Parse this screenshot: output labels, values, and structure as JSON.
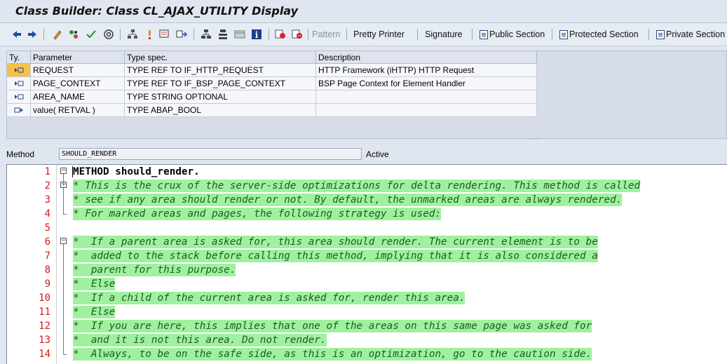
{
  "window": {
    "title": "Class Builder: Class CL_AJAX_UTILITY Display"
  },
  "toolbar": {
    "icons": [
      "back-arrow-icon",
      "forward-arrow-icon",
      "edit-pencil-icon",
      "activate-icon",
      "inspect-icon",
      "where-used-icon",
      "hierarchy-icon",
      "info-marker-icon",
      "display-object-icon",
      "navigate-icon",
      "tree-icon",
      "structure-icon",
      "layout-icon",
      "info-icon",
      "breakpoint-icon",
      "session-breakpoint-icon"
    ],
    "pattern": "Pattern",
    "pretty_printer": "Pretty Printer",
    "signature": "Signature",
    "public_section": "Public Section",
    "protected_section": "Protected Section",
    "private_section": "Private Section"
  },
  "params": {
    "headers": {
      "ty": "Ty.",
      "parameter": "Parameter",
      "type_spec": "Type spec.",
      "description": "Description"
    },
    "rows": [
      {
        "icon": "importing-param-icon",
        "parameter": "REQUEST",
        "type_spec": "TYPE REF TO IF_HTTP_REQUEST",
        "description": "HTTP Framework (iHTTP) HTTP Request"
      },
      {
        "icon": "importing-param-icon",
        "parameter": "PAGE_CONTEXT",
        "type_spec": "TYPE REF TO IF_BSP_PAGE_CONTEXT",
        "description": "BSP Page Context for Element Handler"
      },
      {
        "icon": "importing-param-icon",
        "parameter": "AREA_NAME",
        "type_spec": "TYPE STRING OPTIONAL",
        "description": ""
      },
      {
        "icon": "returning-param-icon",
        "parameter": "value( RETVAL )",
        "type_spec": "TYPE ABAP_BOOL",
        "description": ""
      }
    ]
  },
  "method": {
    "label": "Method",
    "name": "SHOULD_RENDER",
    "status": "Active"
  },
  "editor": {
    "lines": [
      {
        "num": "1",
        "text": "METHOD should_render.",
        "kind": "kw",
        "fold": "minus"
      },
      {
        "num": "2",
        "text": "* This is the crux of the server-side optimizations for delta rendering. This method is called",
        "kind": "cm",
        "fold": "minus"
      },
      {
        "num": "3",
        "text": "* see if any area should render or not. By default, the unmarked areas are always rendered.",
        "kind": "cm",
        "fold": ""
      },
      {
        "num": "4",
        "text": "* For marked areas and pages, the following strategy is used:",
        "kind": "cm",
        "fold": "end"
      },
      {
        "num": "5",
        "text": "",
        "kind": "plain",
        "fold": ""
      },
      {
        "num": "6",
        "text": "*  If a parent area is asked for, this area should render. The current element is to be",
        "kind": "cm",
        "fold": "minus"
      },
      {
        "num": "7",
        "text": "*  added to the stack before calling this method, implying that it is also considered a",
        "kind": "cm",
        "fold": ""
      },
      {
        "num": "8",
        "text": "*  parent for this purpose.",
        "kind": "cm",
        "fold": ""
      },
      {
        "num": "9",
        "text": "*  Else",
        "kind": "cm",
        "fold": ""
      },
      {
        "num": "10",
        "text": "*  If a child of the current area is asked for, render this area.",
        "kind": "cm",
        "fold": ""
      },
      {
        "num": "11",
        "text": "*  Else",
        "kind": "cm",
        "fold": ""
      },
      {
        "num": "12",
        "text": "*  If you are here, this implies that one of the areas on this same page was asked for",
        "kind": "cm",
        "fold": ""
      },
      {
        "num": "13",
        "text": "*  and it is not this area. Do not render.",
        "kind": "cm",
        "fold": ""
      },
      {
        "num": "14",
        "text": "*  Always, to be on the safe side, as this is an optimization, go to the caution side.",
        "kind": "cm",
        "fold": "end"
      }
    ]
  },
  "colors": {
    "comment_bg": "#9ff19f",
    "line_number": "#d21a1a",
    "selected_row": "#f4c24a"
  }
}
